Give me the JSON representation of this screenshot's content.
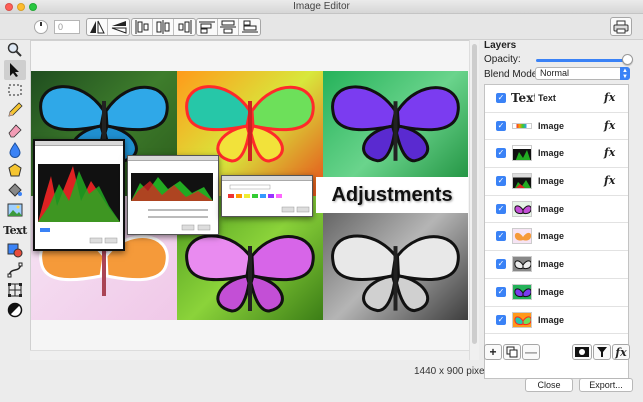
{
  "window": {
    "title": "Image Editor"
  },
  "toolbar": {
    "rotation_value": "0"
  },
  "tools": {
    "text_tool_label": "Text"
  },
  "canvas": {
    "overlay_text": "Adjustments",
    "dimensions": "1440 x 900 pixels"
  },
  "layers": {
    "title": "Layers",
    "opacity_label": "Opacity:",
    "opacity_value": 1.0,
    "blend_label": "Blend Mode:",
    "blend_value": "Normal",
    "thumb_text": "Text",
    "fx_label": "fx",
    "items": [
      {
        "label": "Text",
        "fx": true,
        "checked": true
      },
      {
        "label": "Image",
        "fx": true,
        "checked": true
      },
      {
        "label": "Image",
        "fx": true,
        "checked": true
      },
      {
        "label": "Image",
        "fx": true,
        "checked": true
      },
      {
        "label": "Image",
        "fx": false,
        "checked": true
      },
      {
        "label": "Image",
        "fx": false,
        "checked": true
      },
      {
        "label": "Image",
        "fx": false,
        "checked": true
      },
      {
        "label": "Image",
        "fx": false,
        "checked": true
      },
      {
        "label": "Image",
        "fx": false,
        "checked": true
      }
    ]
  },
  "footer": {
    "close_label": "Close",
    "export_label": "Export..."
  },
  "colors": {
    "accent": "#3a82f6",
    "close_red": "#ff5f57",
    "minimize_yellow": "#febc2e",
    "zoom_green": "#28c840"
  }
}
